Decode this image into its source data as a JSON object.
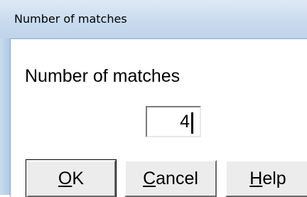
{
  "window": {
    "title": "Number of matches"
  },
  "dialog": {
    "prompt": "Number of matches",
    "value": "4"
  },
  "buttons": {
    "ok": {
      "mnemonic": "O",
      "rest": "K"
    },
    "cancel": {
      "mnemonic": "C",
      "rest": "ancel"
    },
    "help": {
      "mnemonic": "H",
      "rest": "elp"
    }
  }
}
